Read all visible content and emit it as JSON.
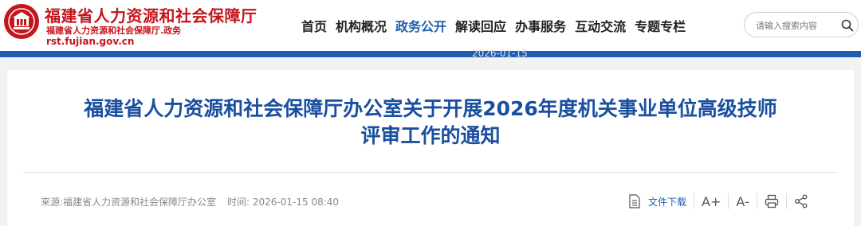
{
  "header": {
    "site_name": "福建省人力资源和社会保障厅",
    "site_sub": "福建省人力资源和社会保障厅.政务",
    "site_domain": "rst.fujian.gov.cn",
    "faint_date": "2026-01-15",
    "nav": [
      {
        "label": "首页"
      },
      {
        "label": "机构概况"
      },
      {
        "label": "政务公开",
        "active": true
      },
      {
        "label": "解读回应"
      },
      {
        "label": "办事服务"
      },
      {
        "label": "互动交流"
      },
      {
        "label": "专题专栏"
      }
    ],
    "search": {
      "placeholder": "请输入搜索内容"
    }
  },
  "article": {
    "title_line1": "福建省人力资源和社会保障厅办公室关于开展2026年度机关事业单位高级技师",
    "title_line2": "评审工作的通知",
    "source": "来源:福建省人力资源和社会保障厅办公室",
    "time": "时间:  2026-01-15 08:40"
  },
  "tools": {
    "download_label": "文件下载",
    "font_increase": "A+",
    "font_decrease": "A-"
  },
  "colors": {
    "brand_red": "#c4161c",
    "brand_blue": "#1e5db3",
    "title_blue": "#1a4fa0"
  },
  "icons": [
    "emblem-logo",
    "search-icon",
    "file-icon",
    "font-increase-icon",
    "font-decrease-icon",
    "print-icon",
    "share-icon"
  ]
}
